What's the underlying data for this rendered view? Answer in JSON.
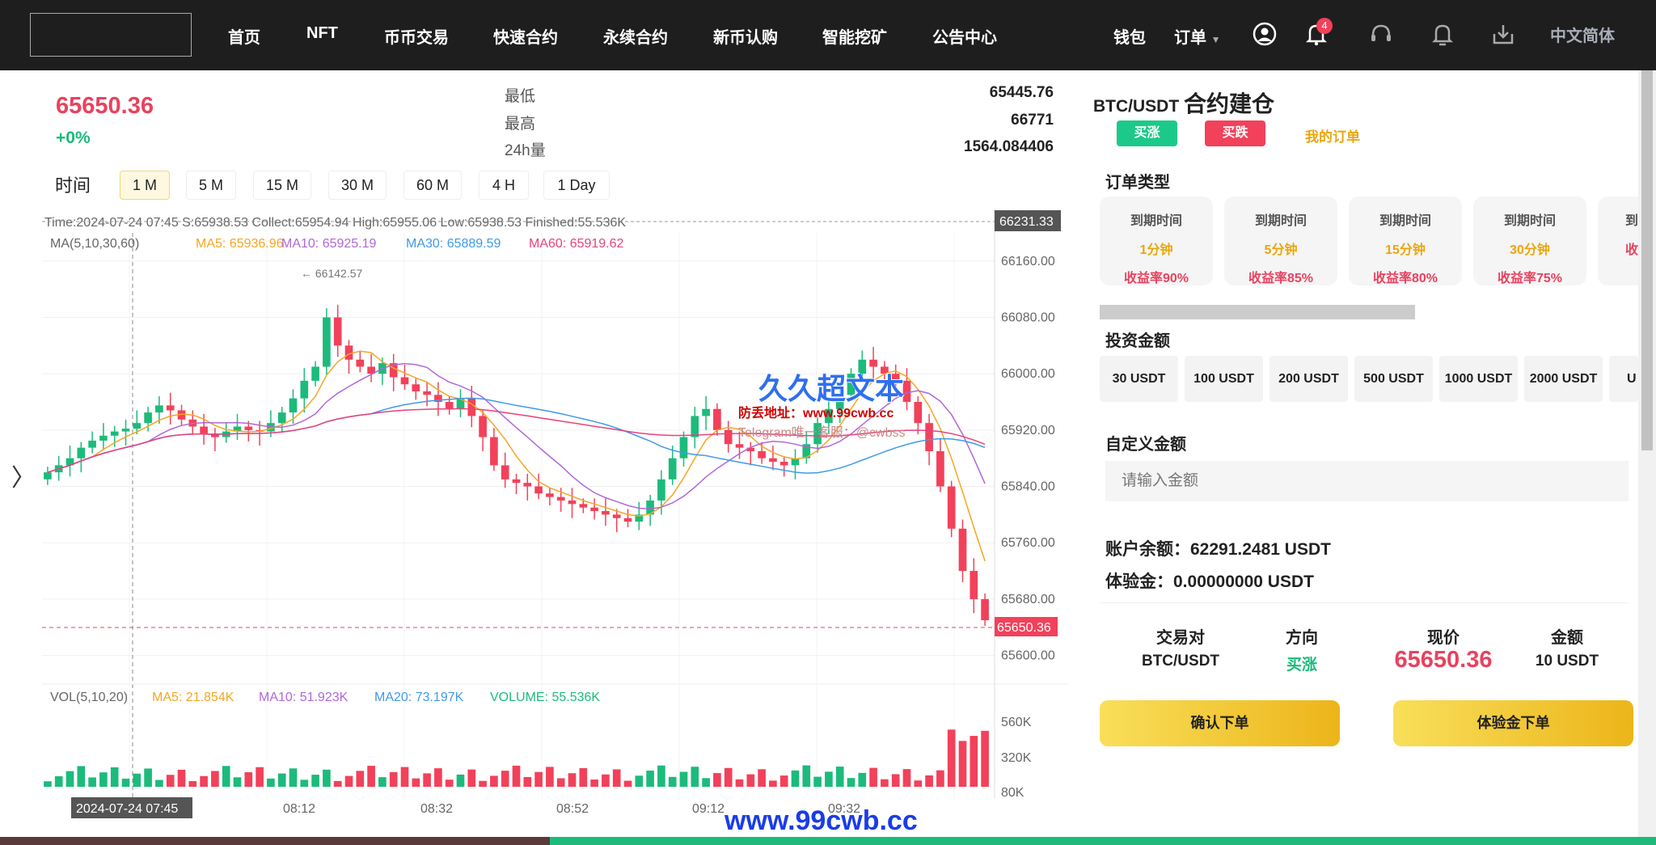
{
  "nav": {
    "items": [
      "首页",
      "NFT",
      "币币交易",
      "快速合约",
      "永续合约",
      "新币认购",
      "智能挖矿",
      "公告中心"
    ],
    "wallet": "钱包",
    "orders": "订单",
    "notifications": "4",
    "language": "中文简体",
    "icons": [
      "user-circle-icon",
      "bell-icon",
      "headset-icon",
      "bell-outline-icon",
      "download-icon"
    ]
  },
  "ticker": {
    "price": "65650.36",
    "change": "+0%",
    "low_label": "最低",
    "low": "65445.76",
    "high_label": "最高",
    "high": "66771",
    "vol_label": "24h量",
    "vol": "1564.084406"
  },
  "timeframes": {
    "label": "时间",
    "options": [
      "1 M",
      "5 M",
      "15 M",
      "30 M",
      "60 M",
      "4 H",
      "1 Day"
    ],
    "selected": "1 M"
  },
  "chart_data": {
    "type": "candlestick",
    "info_line": "Time:2024-07-24 07:45   S:65938.53   Collect:65954.94   High:65955.06   Low:65938.53   Finished:55.536K",
    "ma_title": "MA(5,10,30,60)",
    "ma": [
      {
        "name": "MA5",
        "label": "MA5: 65936.96",
        "color": "#f5a623"
      },
      {
        "name": "MA10",
        "label": "MA10: 65925.19",
        "color": "#b068d8"
      },
      {
        "name": "MA30",
        "label": "MA30: 65889.59",
        "color": "#3f9ae9"
      },
      {
        "name": "MA60",
        "label": "MA60: 65919.62",
        "color": "#e8427c"
      }
    ],
    "y_ticks": [
      "66160.00",
      "66080.00",
      "66000.00",
      "65920.00",
      "65840.00",
      "65760.00",
      "65680.00",
      "65600.00"
    ],
    "y_top_label": "66231.33",
    "current_price_label": "65650.36",
    "max_marker": "66142.57",
    "x_ticks": [
      "08:12",
      "08:32",
      "08:52",
      "09:12",
      "09:32"
    ],
    "crosshair_time": "2024-07-24 07:45",
    "up_color": "#1cbb7b",
    "down_color": "#f2415a",
    "closes": [
      65860,
      65870,
      65880,
      65895,
      65905,
      65912,
      65918,
      65922,
      65930,
      65945,
      65955,
      65948,
      65935,
      65925,
      65915,
      65910,
      65918,
      65925,
      65920,
      65918,
      65930,
      65945,
      65965,
      65990,
      66010,
      66080,
      66040,
      66020,
      66010,
      66000,
      66015,
      65995,
      65985,
      65975,
      65970,
      65960,
      65950,
      65965,
      65940,
      65910,
      65870,
      65850,
      65845,
      65840,
      65830,
      65825,
      65820,
      65815,
      65810,
      65805,
      65800,
      65795,
      65790,
      65800,
      65820,
      65850,
      65880,
      65910,
      65940,
      65950,
      65920,
      65900,
      65895,
      65890,
      65880,
      65875,
      65870,
      65880,
      65900,
      65930,
      65950,
      65970,
      66000,
      66020,
      66010,
      66000,
      65990,
      65960,
      65930,
      65890,
      65840,
      65780,
      65720,
      65680,
      65650
    ]
  },
  "volume": {
    "title": "VOL(5,10,20)",
    "ma5": "MA5: 21.854K",
    "ma10": "MA10: 51.923K",
    "ma20": "MA20: 73.197K",
    "volume": "VOLUME: 55.536K",
    "y_ticks": [
      "560K",
      "320K",
      "80K"
    ]
  },
  "panel": {
    "pair": "BTC/USDT",
    "title": "合约建仓",
    "buy_up": "买涨",
    "buy_down": "买跌",
    "my_orders": "我的订单",
    "order_type_label": "订单类型",
    "cards": [
      {
        "label": "到期时间",
        "time": "1分钟",
        "rate": "收益率90%"
      },
      {
        "label": "到期时间",
        "time": "5分钟",
        "rate": "收益率85%"
      },
      {
        "label": "到期时间",
        "time": "15分钟",
        "rate": "收益率80%"
      },
      {
        "label": "到期时间",
        "time": "30分钟",
        "rate": "收益率75%"
      },
      {
        "label": "到",
        "time": "",
        "rate": "收"
      }
    ],
    "invest_label": "投资金额",
    "amounts": [
      "30 USDT",
      "100 USDT",
      "200 USDT",
      "500 USDT",
      "1000 USDT",
      "2000 USDT",
      "U"
    ],
    "custom_label": "自定义金额",
    "custom_placeholder": "请输入金额",
    "balance": "账户余额：62291.2481 USDT",
    "trial": "体验金：0.00000000 USDT",
    "summary_headers": [
      "交易对",
      "方向",
      "现价",
      "金额"
    ],
    "summary_values": [
      "BTC/USDT",
      "买涨",
      "65650.36",
      "10 USDT"
    ],
    "confirm": "确认下单",
    "trial_order": "体验金下单"
  },
  "watermark": {
    "title": "久久超文本",
    "line1": "防丢地址：www.99cwb.cc",
    "line2": "Telegram唯一客服：@cwbss",
    "footer": "www.99cwb.cc"
  }
}
